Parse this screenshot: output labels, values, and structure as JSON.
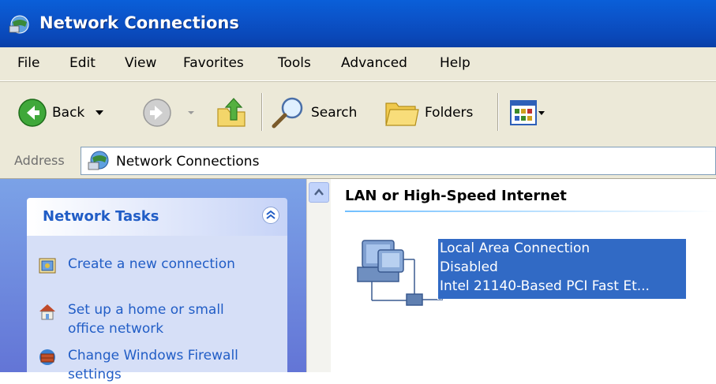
{
  "window": {
    "title": "Network Connections",
    "icon": "network-connections-icon"
  },
  "menu": [
    "File",
    "Edit",
    "View",
    "Favorites",
    "Tools",
    "Advanced",
    "Help"
  ],
  "toolbar": {
    "back_label": "Back",
    "search_label": "Search",
    "folders_label": "Folders"
  },
  "address": {
    "label": "Address",
    "value": "Network Connections"
  },
  "tasks": {
    "header": "Network Tasks",
    "items": [
      {
        "label": "Create a new connection",
        "icon": "new-connection-icon"
      },
      {
        "label": "Set up a home or small office network",
        "icon": "home-network-icon"
      },
      {
        "label": "Change Windows Firewall settings",
        "icon": "firewall-icon"
      }
    ]
  },
  "content": {
    "group_title": "LAN or High-Speed Internet",
    "connection": {
      "name": "Local Area Connection",
      "status": "Disabled",
      "device": "Intel 21140-Based PCI Fast Et..."
    }
  },
  "colors": {
    "title_bar": "#0a53c9",
    "task_link": "#215dc6",
    "selection": "#316ac5",
    "chrome": "#ece9d8"
  }
}
